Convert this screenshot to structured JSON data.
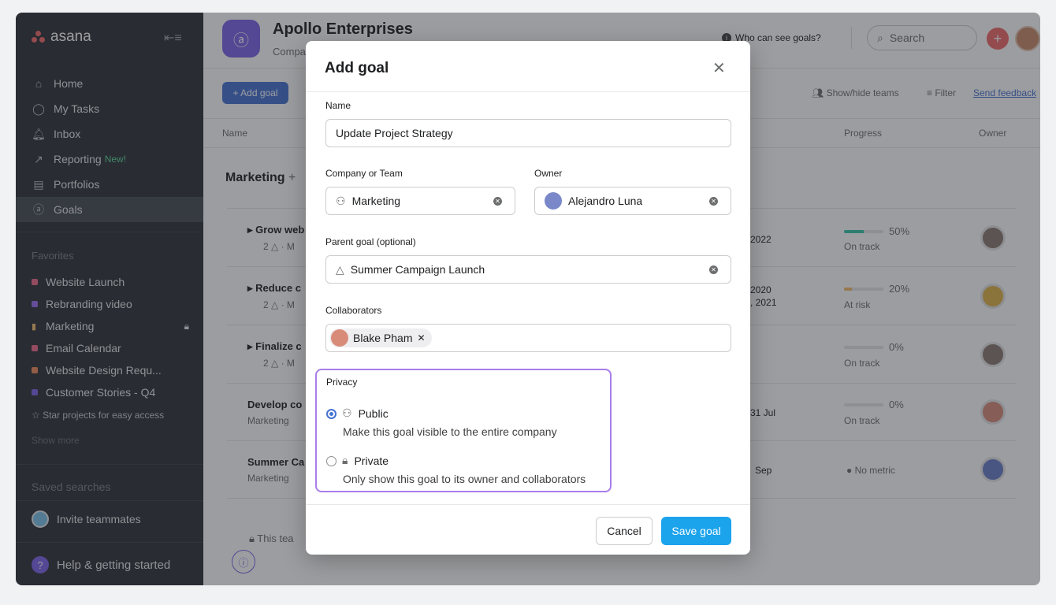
{
  "sidebar": {
    "logo": "asana",
    "nav": [
      {
        "label": "Home",
        "icon": "home-icon"
      },
      {
        "label": "My Tasks",
        "icon": "check-circle-icon"
      },
      {
        "label": "Inbox",
        "icon": "bell-icon"
      },
      {
        "label": "Reporting",
        "badge": "New!",
        "icon": "chart-line-icon"
      },
      {
        "label": "Portfolios",
        "icon": "portfolio-icon"
      },
      {
        "label": "Goals",
        "icon": "goals-icon"
      }
    ],
    "favorites_label": "Favorites",
    "favorites": [
      {
        "label": "Website Launch",
        "color": "#f06a8a"
      },
      {
        "label": "Rebranding video",
        "color": "#9b6ef3"
      },
      {
        "label": "Marketing",
        "color": "#f1bd6c"
      },
      {
        "label": "Email Calendar",
        "color": "#f06a8a"
      },
      {
        "label": "Website Design Requ...",
        "color": "#f08a5d"
      },
      {
        "label": "Customer Stories - Q4",
        "color": "#7d63e9"
      }
    ],
    "star_text": "☆ Star projects for easy access",
    "show_more": "Show more",
    "saved_searches": "Saved searches",
    "invite": "Invite teammates",
    "help": "Help & getting started"
  },
  "header": {
    "title": "Apollo Enterprises",
    "subtitle": "Company",
    "who_can_see": "Who can see goals?",
    "search_placeholder": "Search"
  },
  "toolbar": {
    "add_goal": "+ Add goal",
    "show_hide_teams": "Show/hide teams",
    "filter": "Filter",
    "send_feedback": "Send feedback"
  },
  "columns": {
    "name": "Name",
    "progress": "Progress",
    "owner": "Owner"
  },
  "group": {
    "title": "Marketing",
    "add": "+"
  },
  "rows": [
    {
      "name": "Grow web",
      "sub": "2 △ · M",
      "date": "2022",
      "date2": "",
      "progress": 50,
      "pct": "50%",
      "status": "On track",
      "bar": "#37c5ab",
      "av": "#8a7a72"
    },
    {
      "name": "Reduce c",
      "sub": "2 △ · M",
      "date": "2020",
      "date2": ", 2021",
      "progress": 20,
      "pct": "20%",
      "status": "At risk",
      "bar": "#f1bd6c",
      "av": "#e0b24a"
    },
    {
      "name": "Finalize c",
      "sub": "2 △ · M",
      "date": "",
      "date2": "",
      "progress": 0,
      "pct": "0%",
      "status": "On track",
      "bar": "#37c5ab",
      "av": "#8a7a72"
    },
    {
      "name": "Develop co",
      "sub": "Marketing",
      "date": "31 Jul",
      "date2": "",
      "progress": 0,
      "pct": "0%",
      "status": "On track",
      "bar": "#37c5ab",
      "av": "#d98b7a"
    },
    {
      "name": "Summer Ca",
      "sub": "Marketing",
      "date": "Sep",
      "date2": "",
      "progress": null,
      "pct": "",
      "status": "No metric",
      "bar": "#cccccc",
      "av": "#6a7ec9"
    }
  ],
  "team_footer": "This tea",
  "modal": {
    "title": "Add goal",
    "name_label": "Name",
    "name_value": "Update Project Strategy",
    "team_label": "Company or Team",
    "team_value": "Marketing",
    "owner_label": "Owner",
    "owner_value": "Alejandro Luna",
    "parent_label": "Parent goal (optional)",
    "parent_value": "Summer Campaign Launch",
    "collab_label": "Collaborators",
    "collab_value": "Blake Pham",
    "privacy_label": "Privacy",
    "public_title": "Public",
    "public_desc": "Make this goal visible to the entire company",
    "private_title": "Private",
    "private_desc": "Only show this goal to its owner and collaborators",
    "selected": "public",
    "cancel": "Cancel",
    "save": "Save goal"
  }
}
